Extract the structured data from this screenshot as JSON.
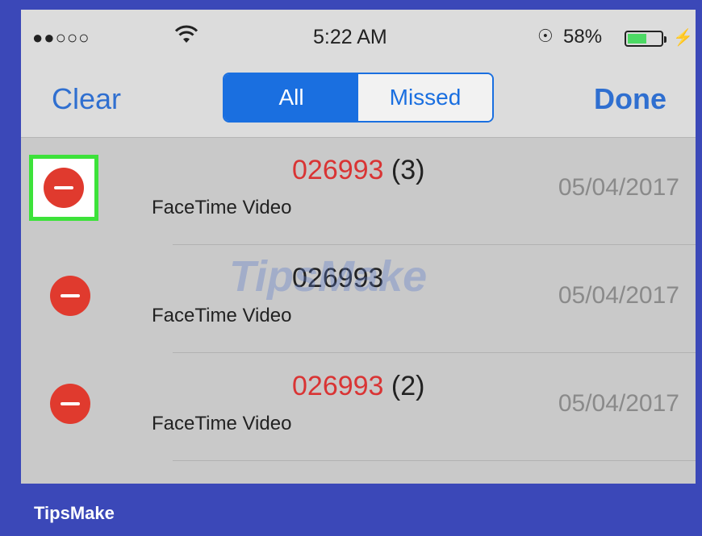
{
  "status_bar": {
    "signal": "●●○○○",
    "time": "5:22 AM",
    "battery_percent": "58%",
    "battery_level": 0.58,
    "icons": [
      "wifi-icon",
      "rotation-lock-icon",
      "battery-icon",
      "charging-bolt-icon"
    ]
  },
  "nav": {
    "clear_label": "Clear",
    "done_label": "Done",
    "segments": [
      "All",
      "Missed"
    ],
    "selected_segment": "All"
  },
  "calls": [
    {
      "number": "026993",
      "count": "(3)",
      "type": "FaceTime Video",
      "date": "05/04/2017",
      "missed": true
    },
    {
      "number": "026993",
      "count": "",
      "type": "FaceTime Video",
      "date": "05/04/2017",
      "missed": false
    },
    {
      "number": "026993",
      "count": "(2)",
      "type": "FaceTime Video",
      "date": "05/04/2017",
      "missed": true
    }
  ],
  "watermark": "TipsMake",
  "footer": "TipsMake",
  "colors": {
    "accent": "#1a6fe0",
    "missed": "#d93434",
    "delete": "#e03a2e",
    "highlight": "#3de23a",
    "frame": "#3b48b8"
  }
}
